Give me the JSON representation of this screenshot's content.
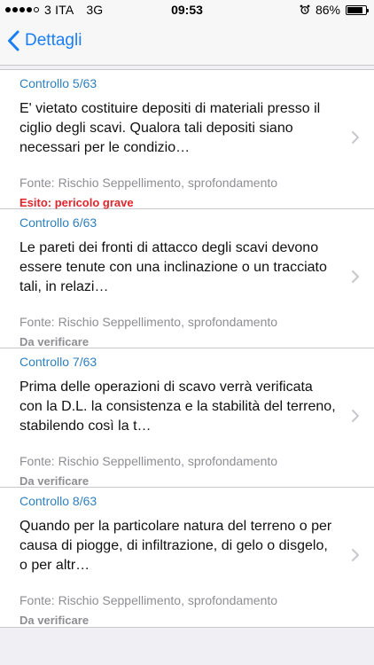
{
  "status_bar": {
    "carrier": "3 ITA",
    "network": "3G",
    "time": "09:53",
    "battery": "86%",
    "battery_level": 0.86,
    "signal_bars_filled": 4,
    "signal_bars_total": 5
  },
  "nav": {
    "back_label": "Dettagli",
    "accent_color": "#1a7ef5"
  },
  "items": [
    {
      "header": "Controllo 5/63",
      "body": "E' vietato costituire depositi di materiali presso il ciglio degli scavi. Qualora tali depositi siano necessari per le condizio…",
      "source": "Fonte: Rischio Seppellimento, sprofondamento",
      "status": "Esito: pericolo grave",
      "status_color": "#e0252b"
    },
    {
      "header": "Controllo 6/63",
      "body": "Le pareti dei fronti di attacco degli scavi devono essere tenute con una inclinazione o un tracciato tali, in relazi…",
      "source": "Fonte: Rischio Seppellimento, sprofondamento",
      "status": "Da verificare",
      "status_color": "#8e8e93"
    },
    {
      "header": "Controllo 7/63",
      "body": "Prima delle operazioni di scavo verrà verificata con la D.L. la consistenza e la stabilità del terreno, stabilendo così la t…",
      "source": "Fonte: Rischio Seppellimento, sprofondamento",
      "status": "Da verificare",
      "status_color": "#8e8e93"
    },
    {
      "header": "Controllo 8/63",
      "body": "Quando per la particolare natura del terreno o per causa di piogge, di infiltrazione, di gelo o disgelo, o per altr…",
      "source": "Fonte: Rischio Seppellimento, sprofondamento",
      "status": "Da verificare",
      "status_color": "#8e8e93"
    }
  ]
}
